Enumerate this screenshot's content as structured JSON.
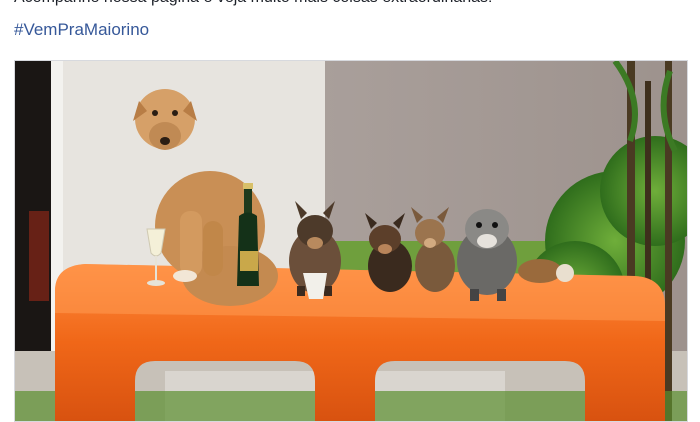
{
  "post": {
    "text": "Acompanhe nossa página e veja muito mais coisas extraordinárias!",
    "hashtag": "#VemPraMaiorino"
  },
  "photo": {
    "subject": "dogs-on-orange-table"
  },
  "colors": {
    "link": "#365899",
    "text": "#1d2129",
    "table": "#f26a1b",
    "wall": "#a79d99"
  }
}
